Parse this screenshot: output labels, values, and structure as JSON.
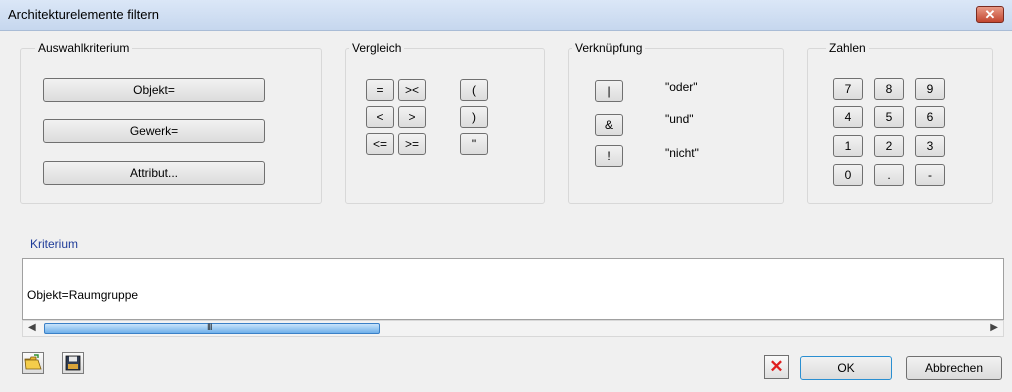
{
  "window": {
    "title": "Architekturelemente filtern",
    "close_glyph": "✕"
  },
  "auswahl": {
    "legend": "Auswahlkriterium",
    "buttons": [
      "Objekt=",
      "Gewerk=",
      "Attribut..."
    ]
  },
  "vergleich": {
    "legend": "Vergleich",
    "buttons": [
      "=",
      "><",
      "(",
      "<",
      ">",
      ")",
      "<=",
      ">=",
      "\""
    ]
  },
  "verknuepfung": {
    "legend": "Verknüpfung",
    "buttons": [
      "|",
      "&",
      "!"
    ],
    "labels": [
      "\"oder\"",
      "\"und\"",
      "\"nicht\""
    ]
  },
  "zahlen": {
    "legend": "Zahlen",
    "buttons": [
      "7",
      "8",
      "9",
      "4",
      "5",
      "6",
      "1",
      "2",
      "3",
      "0",
      ".",
      "-"
    ]
  },
  "kriterium": {
    "label": "Kriterium",
    "value": "Objekt=Raumgruppe"
  },
  "scrollbar": {
    "left_arrow": "◀",
    "right_arrow": "▶",
    "grip": "III"
  },
  "footer": {
    "open_icon": "folder-open-icon",
    "save_icon": "save-icon",
    "delete_glyph": "✕",
    "ok_label": "OK",
    "cancel_label": "Abbrechen"
  },
  "colors": {
    "title_bar": "#c6d7ee",
    "kriterium_label": "#1f3c99",
    "delete": "#e01e1e",
    "thumb": "#6fb0ea"
  }
}
